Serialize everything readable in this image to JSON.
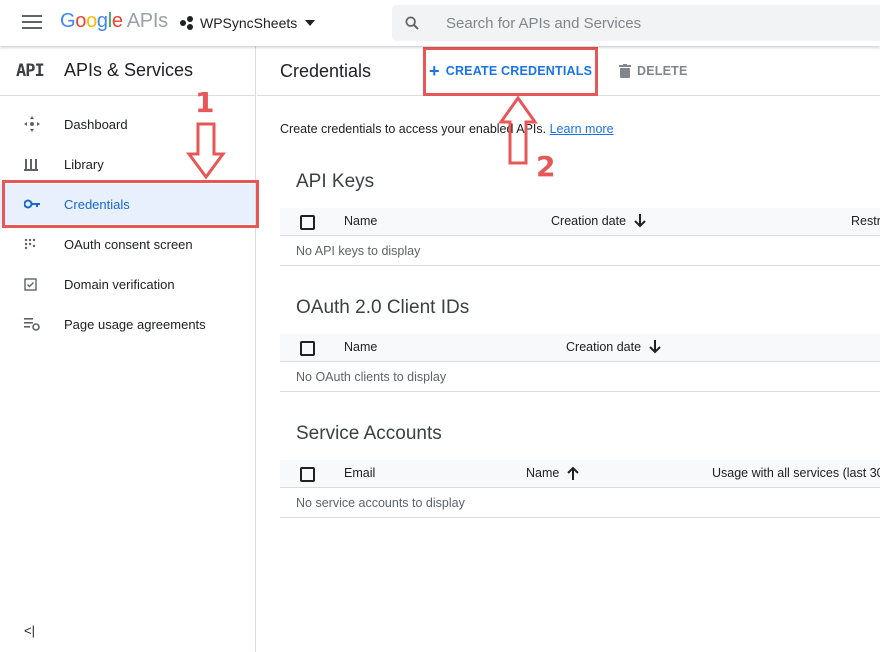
{
  "topbar": {
    "logo_google": [
      "G",
      "o",
      "o",
      "g",
      "l",
      "e"
    ],
    "logo_apis": "APIs",
    "project_name": "WPSyncSheets",
    "search_placeholder": "Search for APIs and Services"
  },
  "sidebar": {
    "badge": "API",
    "title": "APIs & Services",
    "items": [
      {
        "label": "Dashboard",
        "icon": "dashboard-icon",
        "active": false
      },
      {
        "label": "Library",
        "icon": "library-icon",
        "active": false
      },
      {
        "label": "Credentials",
        "icon": "key-icon",
        "active": true
      },
      {
        "label": "OAuth consent screen",
        "icon": "consent-icon",
        "active": false
      },
      {
        "label": "Domain verification",
        "icon": "checkbox-icon",
        "active": false
      },
      {
        "label": "Page usage agreements",
        "icon": "settings-list-icon",
        "active": false
      }
    ],
    "collapse_label": "<|"
  },
  "main": {
    "title": "Credentials",
    "create_label": "CREATE CREDENTIALS",
    "delete_label": "DELETE",
    "intro_text": "Create credentials to access your enabled APIs.",
    "learn_more": "Learn more",
    "sections": [
      {
        "title": "API Keys",
        "columns": [
          "Name",
          "Creation date",
          "Restr"
        ],
        "empty": "No API keys to display"
      },
      {
        "title": "OAuth 2.0 Client IDs",
        "columns": [
          "Name",
          "Creation date"
        ],
        "empty": "No OAuth clients to display"
      },
      {
        "title": "Service Accounts",
        "columns": [
          "Email",
          "Name",
          "Usage with all services (last 30"
        ],
        "empty": "No service accounts to display"
      }
    ]
  },
  "annotations": {
    "step1": "1",
    "step2": "2",
    "color": "#e85757"
  },
  "colors": {
    "accent": "#1a73e8",
    "active_bg": "#e8f0fe",
    "active_text": "#1967d2"
  }
}
